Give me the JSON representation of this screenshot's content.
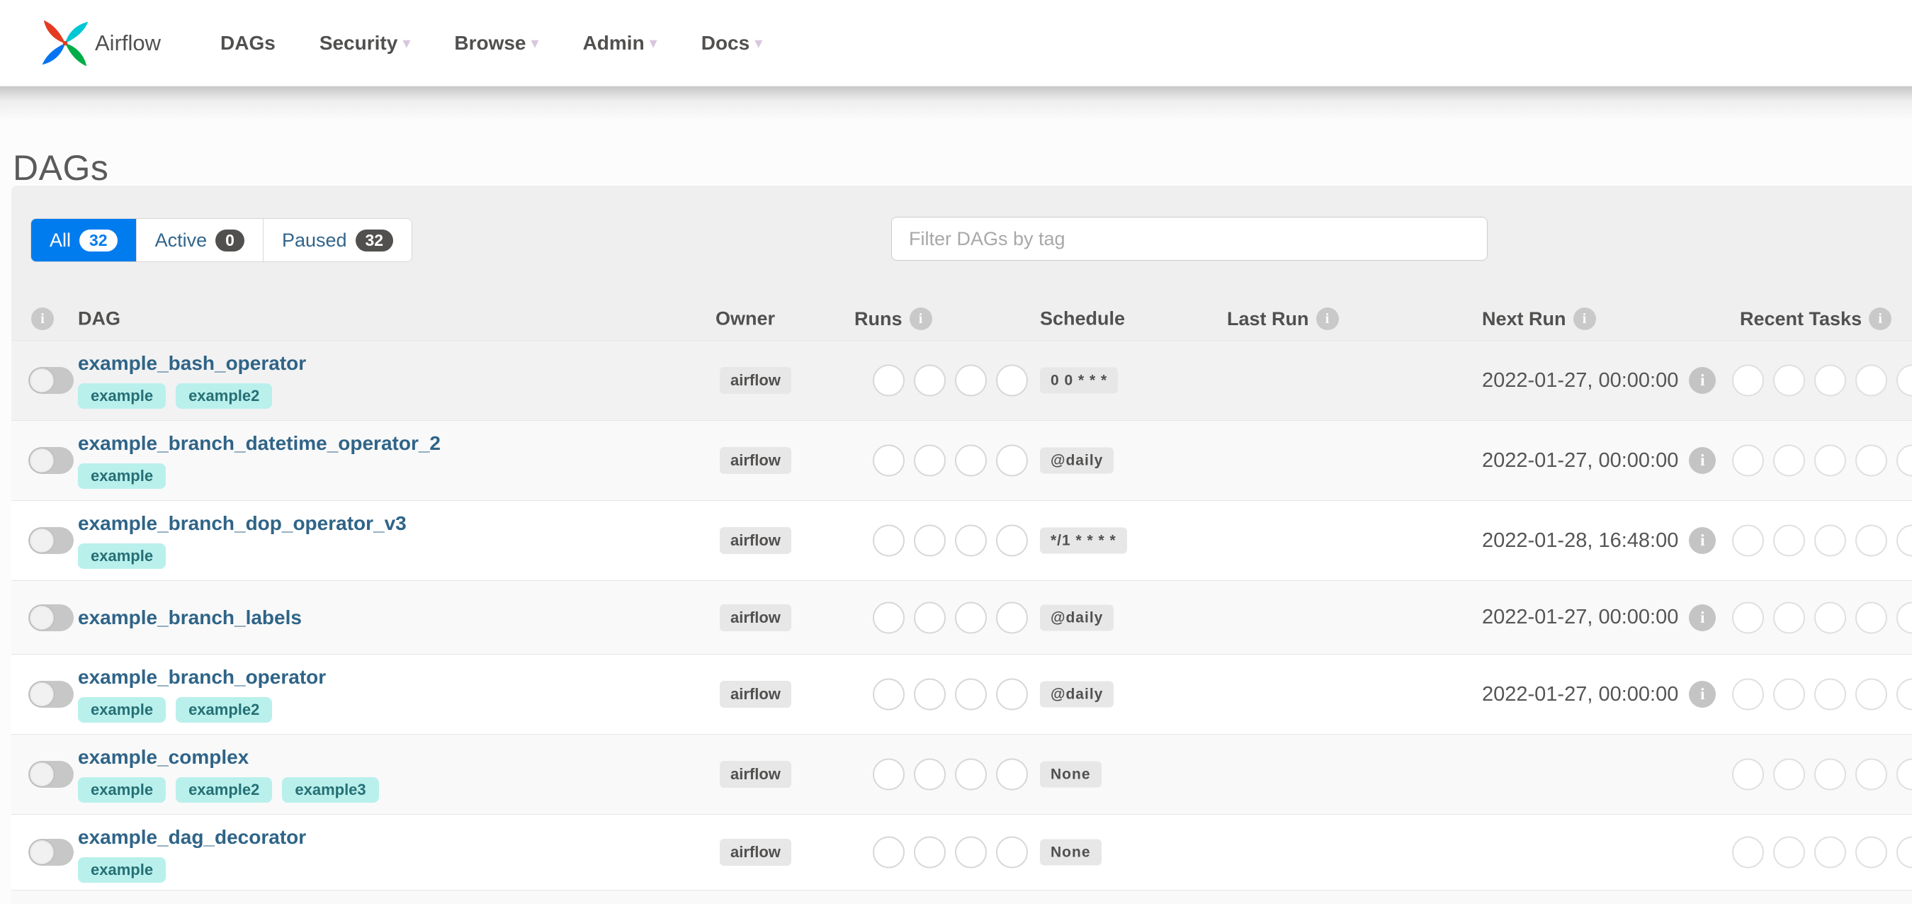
{
  "navbar": {
    "brand": "Airflow",
    "items": [
      {
        "label": "DAGs",
        "dropdown": false
      },
      {
        "label": "Security",
        "dropdown": true
      },
      {
        "label": "Browse",
        "dropdown": true
      },
      {
        "label": "Admin",
        "dropdown": true
      },
      {
        "label": "Docs",
        "dropdown": true
      }
    ]
  },
  "page": {
    "title": "DAGs"
  },
  "filter_bar": {
    "tabs": [
      {
        "label": "All",
        "count": "32",
        "active": true
      },
      {
        "label": "Active",
        "count": "0",
        "active": false
      },
      {
        "label": "Paused",
        "count": "32",
        "active": false
      }
    ],
    "tag_filter_placeholder": "Filter DAGs by tag"
  },
  "table": {
    "columns": [
      {
        "label": "",
        "info": true
      },
      {
        "label": "DAG",
        "info": false
      },
      {
        "label": "Owner",
        "info": false
      },
      {
        "label": "Runs",
        "info": true
      },
      {
        "label": "Schedule",
        "info": false
      },
      {
        "label": "Last Run",
        "info": true
      },
      {
        "label": "Next Run",
        "info": true
      },
      {
        "label": "Recent Tasks",
        "info": true
      }
    ],
    "rows": [
      {
        "name": "example_bash_operator",
        "tags": [
          "example",
          "example2"
        ],
        "owner": "airflow",
        "toggle": "off",
        "runs_circles": 4,
        "schedule": "0 0 * * *",
        "last_run": "",
        "next_run": "2022-01-27, 00:00:00",
        "recent_task_circles": 5
      },
      {
        "name": "example_branch_datetime_operator_2",
        "tags": [
          "example"
        ],
        "owner": "airflow",
        "toggle": "off",
        "runs_circles": 4,
        "schedule": "@daily",
        "last_run": "",
        "next_run": "2022-01-27, 00:00:00",
        "recent_task_circles": 5
      },
      {
        "name": "example_branch_dop_operator_v3",
        "tags": [
          "example"
        ],
        "owner": "airflow",
        "toggle": "off",
        "runs_circles": 4,
        "schedule": "*/1 * * * *",
        "last_run": "",
        "next_run": "2022-01-28, 16:48:00",
        "recent_task_circles": 5
      },
      {
        "name": "example_branch_labels",
        "tags": [],
        "owner": "airflow",
        "toggle": "off",
        "runs_circles": 4,
        "schedule": "@daily",
        "last_run": "",
        "next_run": "2022-01-27, 00:00:00",
        "recent_task_circles": 5
      },
      {
        "name": "example_branch_operator",
        "tags": [
          "example",
          "example2"
        ],
        "owner": "airflow",
        "toggle": "off",
        "runs_circles": 4,
        "schedule": "@daily",
        "last_run": "",
        "next_run": "2022-01-27, 00:00:00",
        "recent_task_circles": 5
      },
      {
        "name": "example_complex",
        "tags": [
          "example",
          "example2",
          "example3"
        ],
        "owner": "airflow",
        "toggle": "off",
        "runs_circles": 4,
        "schedule": "None",
        "last_run": "",
        "next_run": "",
        "recent_task_circles": 5
      },
      {
        "name": "example_dag_decorator",
        "tags": [
          "example"
        ],
        "owner": "airflow",
        "toggle": "off",
        "runs_circles": 4,
        "schedule": "None",
        "last_run": "",
        "next_run": "",
        "recent_task_circles": 5
      }
    ]
  },
  "icons": {
    "info": "i",
    "dropdown_caret": "▾",
    "logo": "airflow-pinwheel-logo"
  },
  "colors": {
    "accent_blue": "#017cee",
    "link_blue": "#2f6488",
    "tag_bg": "#b9f0ec",
    "tag_text": "#266f75",
    "badge_bg": "#e7e7e7",
    "dark_badge": "#51504f",
    "logo_red": "#e43a21",
    "logo_teal": "#00c7d4",
    "logo_blue": "#0674f0",
    "logo_green": "#00ad46"
  }
}
